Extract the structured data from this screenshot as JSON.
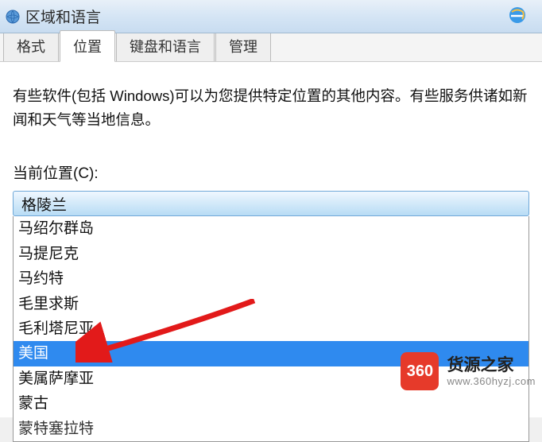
{
  "window": {
    "title": "区域和语言"
  },
  "tabs": {
    "items": [
      {
        "label": "格式"
      },
      {
        "label": "位置"
      },
      {
        "label": "键盘和语言"
      },
      {
        "label": "管理"
      }
    ],
    "active_index": 1
  },
  "content": {
    "description": "有些软件(包括 Windows)可以为您提供特定位置的其他内容。有些服务供诸如新闻和天气等当地信息。",
    "location_label": "当前位置(C):"
  },
  "dropdown": {
    "selected": "格陵兰",
    "options": [
      "马绍尔群岛",
      "马提尼克",
      "马约特",
      "毛里求斯",
      "毛利塔尼亚",
      "美国",
      "美属萨摩亚",
      "蒙古",
      "蒙特塞拉特"
    ],
    "highlighted_index": 5
  },
  "watermark": {
    "badge": "360",
    "title": "货源之家",
    "url": "www.360hyzj.com"
  }
}
